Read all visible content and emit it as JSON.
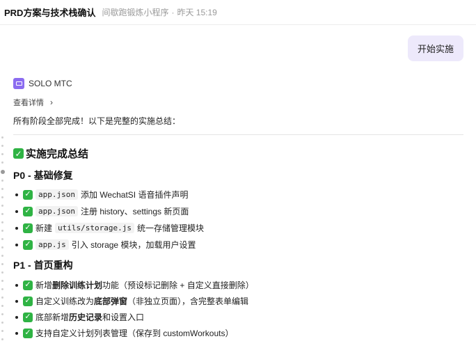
{
  "header": {
    "title": "PRD方案与技术栈确认",
    "subtitle": "间歇跑锻炼小程序",
    "separator": "·",
    "time": "昨天 15:19"
  },
  "user_message": {
    "text": "开始实施"
  },
  "agent": {
    "name": "SOLO MTC",
    "details_label": "查看详情",
    "intro": "所有阶段全部完成！以下是完整的实施总结："
  },
  "summary": {
    "heading": "实施完成总结",
    "p0": {
      "title": "P0 - 基础修复",
      "items": [
        {
          "code": "app.json",
          "text": "添加 WechatSI 语音插件声明"
        },
        {
          "code": "app.json",
          "text": "注册 history、settings 新页面"
        },
        {
          "pre": "新建",
          "code": "utils/storage.js",
          "text": "统一存储管理模块"
        },
        {
          "code": "app.js",
          "text": "引入 storage 模块，加载用户设置"
        }
      ]
    },
    "p1": {
      "title": "P1 - 首页重构",
      "items": [
        {
          "pre": "新增",
          "bold": "删除训练计划",
          "post": "功能（预设标记删除 + 自定义直接删除）"
        },
        {
          "pre": "自定义训练改为",
          "bold": "底部弹窗",
          "post": "（非独立页面），含完整表单编辑"
        },
        {
          "pre": "底部新增",
          "bold": "历史记录",
          "post": "和设置入口"
        },
        {
          "pre": "支持自定义计划列表管理（保存到 customWorkouts）"
        }
      ]
    }
  },
  "colors": {
    "accent": "#8b6cf0",
    "bubble": "#ede9fb",
    "check": "#2fb344"
  },
  "icons": {
    "agent": "monitor-icon",
    "details": "chevron-right-icon",
    "done": "check-mark-icon"
  }
}
